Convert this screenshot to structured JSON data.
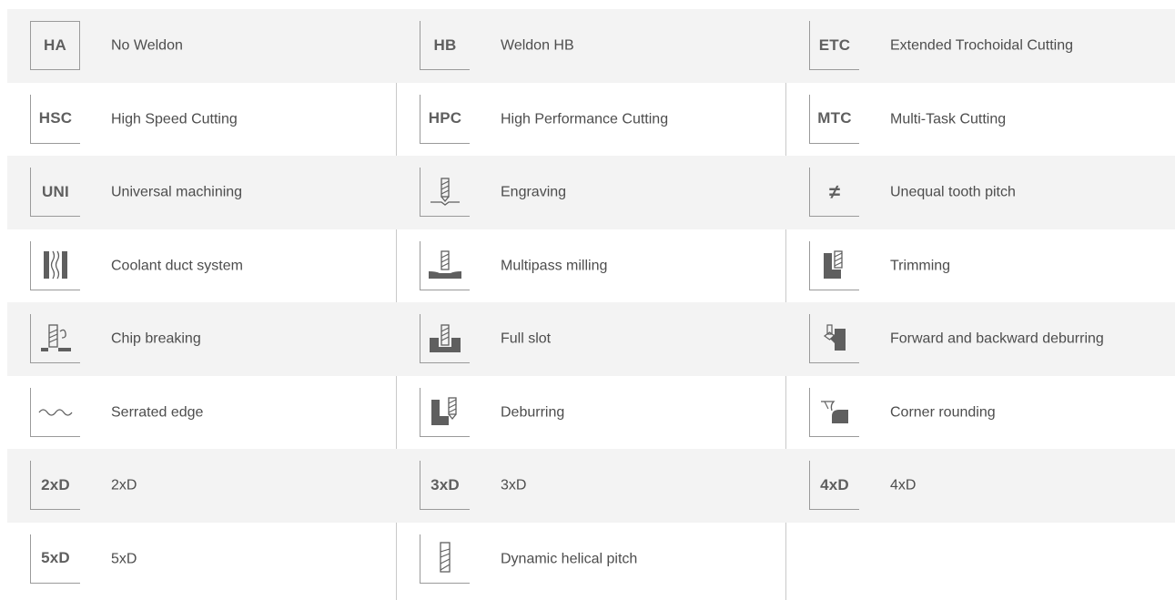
{
  "legend": {
    "columns": [
      [
        {
          "icon_name": "ha-icon",
          "code": "HA",
          "label": "No Weldon"
        },
        {
          "icon_name": "hsc-icon",
          "code": "HSC",
          "label": "High Speed Cutting"
        },
        {
          "icon_name": "uni-icon",
          "code": "UNI",
          "label": "Universal machining"
        },
        {
          "icon_name": "coolant-duct-icon",
          "label": "Coolant duct system"
        },
        {
          "icon_name": "chip-breaking-icon",
          "label": "Chip breaking"
        },
        {
          "icon_name": "serrated-edge-icon",
          "label": "Serrated edge"
        },
        {
          "icon_name": "2xd-icon",
          "code": "2xD",
          "label": "2xD"
        },
        {
          "icon_name": "5xd-icon",
          "code": "5xD",
          "label": "5xD"
        }
      ],
      [
        {
          "icon_name": "hb-icon",
          "code": "HB",
          "label": "Weldon HB"
        },
        {
          "icon_name": "hpc-icon",
          "code": "HPC",
          "label": "High Performance Cutting"
        },
        {
          "icon_name": "engraving-icon",
          "label": "Engraving"
        },
        {
          "icon_name": "multipass-milling-icon",
          "label": "Multipass milling"
        },
        {
          "icon_name": "full-slot-icon",
          "label": "Full slot"
        },
        {
          "icon_name": "deburring-icon",
          "label": "Deburring"
        },
        {
          "icon_name": "3xd-icon",
          "code": "3xD",
          "label": "3xD"
        },
        {
          "icon_name": "dynamic-helical-pitch-icon",
          "label": "Dynamic helical pitch"
        }
      ],
      [
        {
          "icon_name": "etc-icon",
          "code": "ETC",
          "label": "Extended Trochoidal Cutting"
        },
        {
          "icon_name": "mtc-icon",
          "code": "MTC",
          "label": "Multi-Task Cutting"
        },
        {
          "icon_name": "unequal-tooth-pitch-icon",
          "code": "≠",
          "label": "Unequal tooth pitch"
        },
        {
          "icon_name": "trimming-icon",
          "label": "Trimming"
        },
        {
          "icon_name": "forward-backward-deburring-icon",
          "label": "Forward and backward deburring"
        },
        {
          "icon_name": "corner-rounding-icon",
          "label": "Corner rounding"
        },
        {
          "icon_name": "4xd-icon",
          "code": "4xD",
          "label": "4xD"
        }
      ]
    ]
  },
  "colors": {
    "row_shade": "#f3f3f3",
    "icon_border": "#9a9a9a",
    "icon_text": "#5f5f5f",
    "label_text": "#4d4d4d",
    "separator": "#c9c9c9"
  }
}
